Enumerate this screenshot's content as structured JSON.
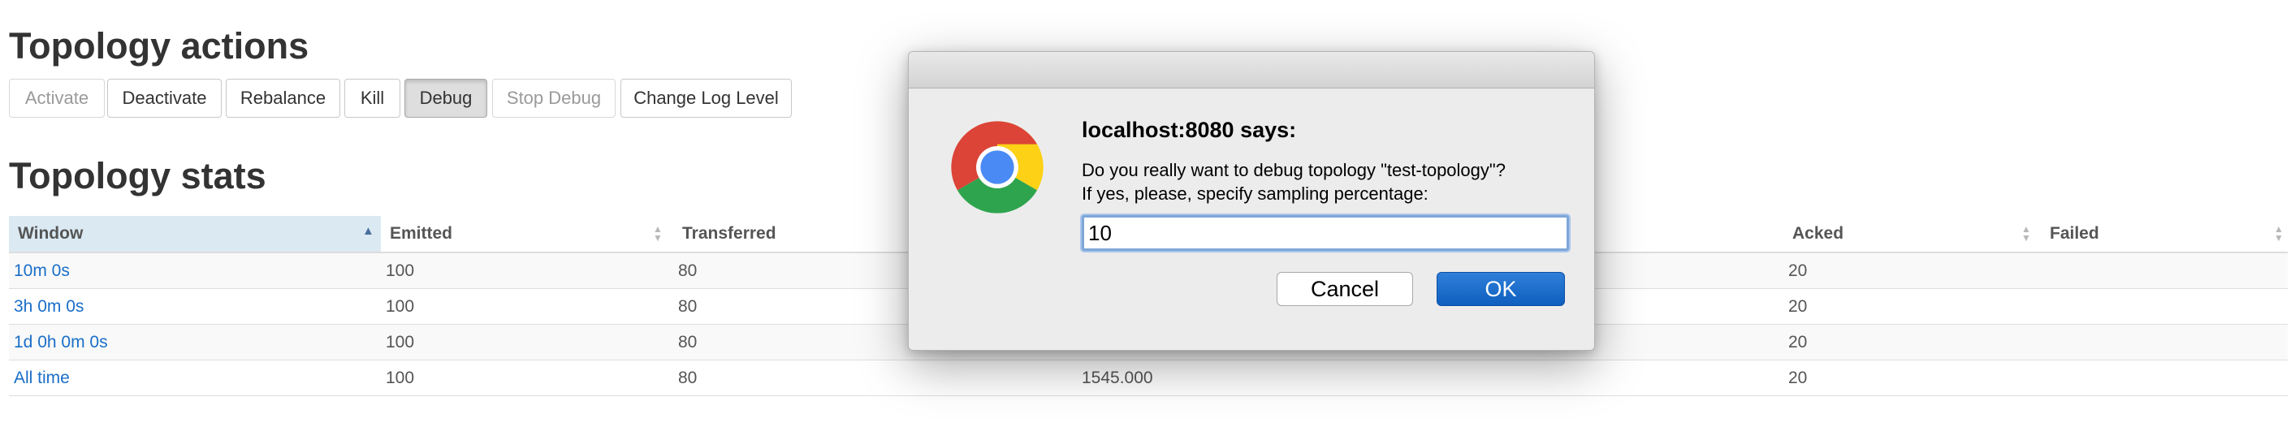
{
  "actions": {
    "title": "Topology actions",
    "buttons": [
      {
        "label": "Activate",
        "state": "disabled"
      },
      {
        "label": "Deactivate",
        "state": "enabled"
      },
      {
        "label": "Rebalance",
        "state": "enabled"
      },
      {
        "label": "Kill",
        "state": "enabled"
      },
      {
        "label": "Debug",
        "state": "active"
      },
      {
        "label": "Stop Debug",
        "state": "disabled"
      },
      {
        "label": "Change Log Level",
        "state": "enabled"
      }
    ]
  },
  "stats": {
    "title": "Topology stats",
    "columns": [
      "Window",
      "Emitted",
      "Transferred",
      "",
      "",
      "Acked",
      "Failed"
    ],
    "rows": [
      {
        "window": "10m 0s",
        "emitted": "100",
        "transferred": "80",
        "latency": "",
        "acked": "20",
        "failed": ""
      },
      {
        "window": "3h 0m 0s",
        "emitted": "100",
        "transferred": "80",
        "latency": "",
        "acked": "20",
        "failed": ""
      },
      {
        "window": "1d 0h 0m 0s",
        "emitted": "100",
        "transferred": "80",
        "latency": "",
        "acked": "20",
        "failed": ""
      },
      {
        "window": "All time",
        "emitted": "100",
        "transferred": "80",
        "latency": "1545.000",
        "acked": "20",
        "failed": ""
      }
    ]
  },
  "dialog": {
    "heading": "localhost:8080 says:",
    "message_line1": "Do you really want to debug topology \"test-topology\"?",
    "message_line2": "If yes, please, specify sampling percentage:",
    "input_value": "10",
    "cancel_label": "Cancel",
    "ok_label": "OK"
  },
  "colors": {
    "link": "#1a6ec8",
    "sorted_header_bg": "#dbe9f3",
    "ok_button": "#1a6ec8"
  },
  "icons": {
    "browser_logo": "chrome-logo-icon",
    "sort": "sort-icon",
    "sort_ascending": "sort-ascending-icon"
  }
}
